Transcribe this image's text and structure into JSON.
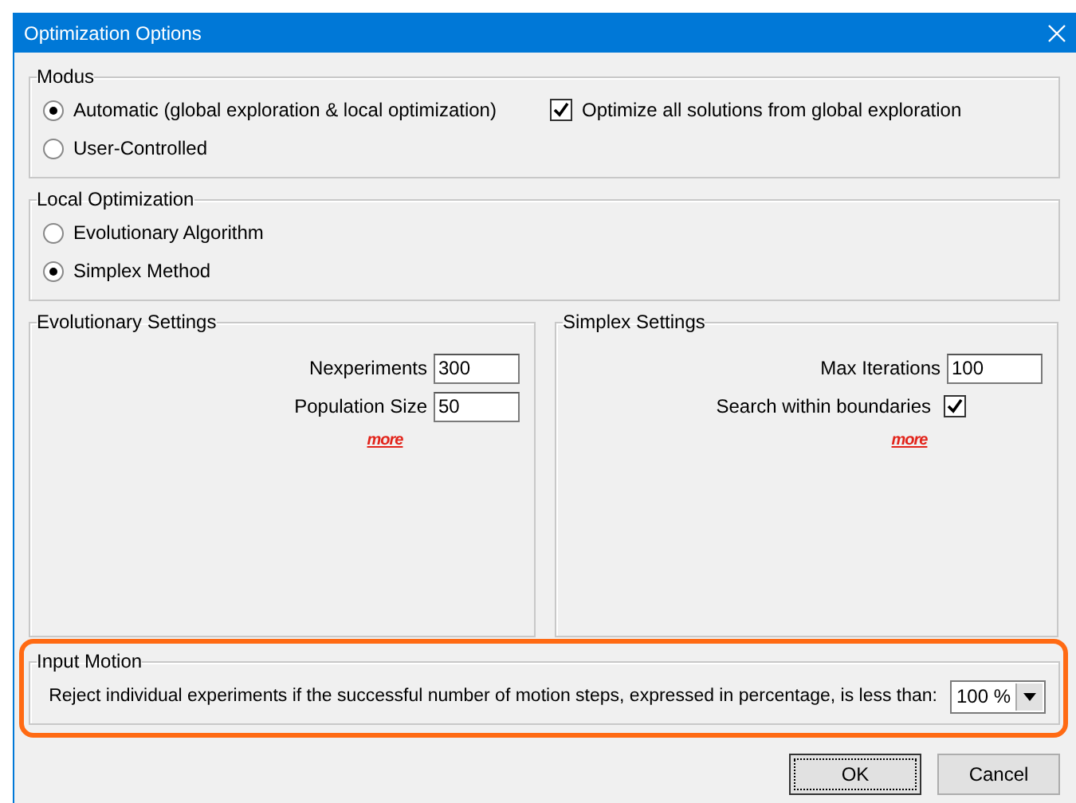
{
  "window": {
    "title": "Optimization Options"
  },
  "modus": {
    "title": "Modus",
    "options": [
      {
        "label": "Automatic (global exploration & local optimization)",
        "selected": true
      },
      {
        "label": "User-Controlled",
        "selected": false
      }
    ],
    "optimize_all": {
      "label": "Optimize all solutions from global exploration",
      "checked": true
    }
  },
  "local_optimization": {
    "title": "Local Optimization",
    "options": [
      {
        "label": "Evolutionary Algorithm",
        "selected": false
      },
      {
        "label": "Simplex Method",
        "selected": true
      }
    ]
  },
  "evolutionary_settings": {
    "title": "Evolutionary Settings",
    "fields": [
      {
        "label": "Nexperiments",
        "value": "300"
      },
      {
        "label": "Population Size",
        "value": "50"
      }
    ],
    "link": "more"
  },
  "simplex_settings": {
    "title": "Simplex Settings",
    "max_iterations": {
      "label": "Max Iterations",
      "value": "100"
    },
    "search_within_boundaries": {
      "label": "Search within boundaries",
      "checked": true
    },
    "link": "more"
  },
  "input_motion": {
    "title": "Input Motion",
    "label": "Reject individual experiments if the successful number of motion steps, expressed in percentage, is less than:",
    "value": "100 %",
    "highlighted": true
  },
  "buttons": [
    {
      "label": "OK",
      "default": true
    },
    {
      "label": "Cancel",
      "default": false
    }
  ]
}
